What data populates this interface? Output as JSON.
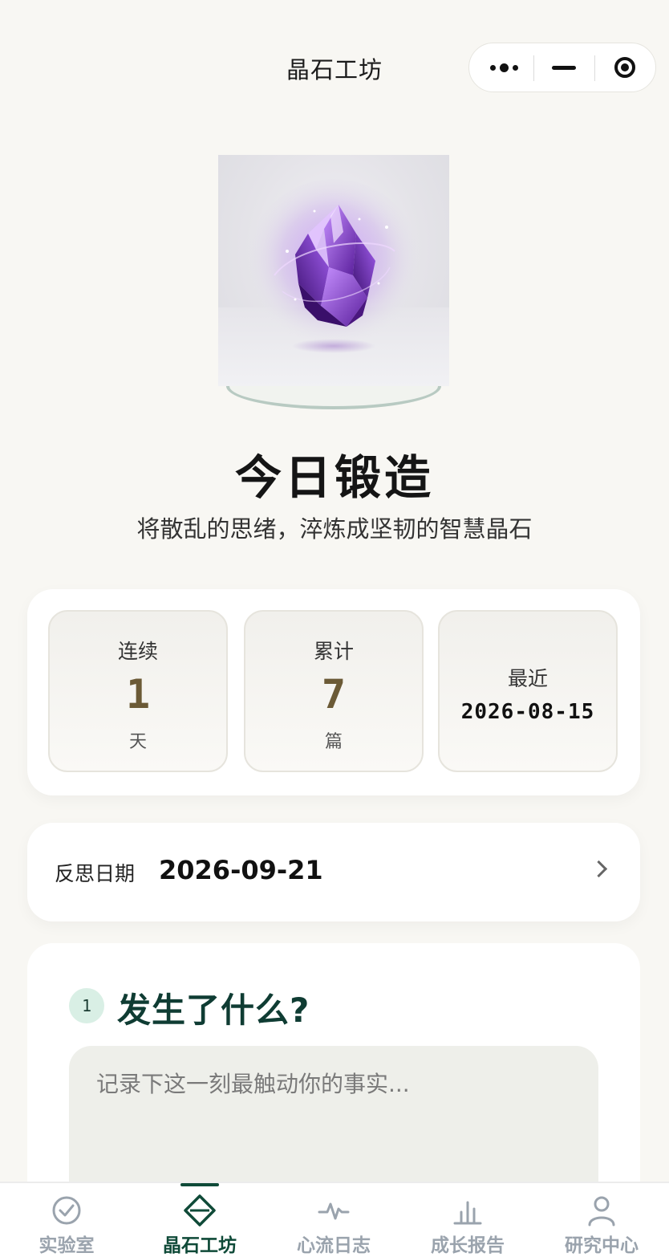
{
  "nav": {
    "title": "晶石工坊",
    "capsule_icons": [
      "more-dots-icon",
      "minimize-icon",
      "close-target-icon"
    ]
  },
  "hero": {
    "title": "今日锻造",
    "subtitle": "将散乱的思绪，淬炼成坚韧的智慧晶石"
  },
  "stats": {
    "streak": {
      "label": "连续",
      "value": "1",
      "unit": "天"
    },
    "total": {
      "label": "累计",
      "value": "7",
      "unit": "篇"
    },
    "recent": {
      "label": "最近",
      "date": "2026-08-15"
    }
  },
  "date_row": {
    "label": "反思日期",
    "value": "2026-09-21"
  },
  "question": {
    "step": "1",
    "title": "发生了什么?",
    "placeholder": "记录下这一刻最触动你的事实..."
  },
  "tabbar": {
    "items": [
      {
        "label": "实验室",
        "icon": "check-circle-icon"
      },
      {
        "label": "晶石工坊",
        "icon": "diamond-icon",
        "active": true
      },
      {
        "label": "心流日志",
        "icon": "pulse-icon"
      },
      {
        "label": "成长报告",
        "icon": "bar-chart-icon"
      },
      {
        "label": "研究中心",
        "icon": "user-icon"
      }
    ]
  },
  "colors": {
    "background": "#f8f7f3",
    "card": "#ffffff",
    "accent_green": "#0f4a38",
    "stat_number": "#6b5a36",
    "tab_inactive": "#9aa3ad",
    "step_badge": "#d9efe5"
  }
}
